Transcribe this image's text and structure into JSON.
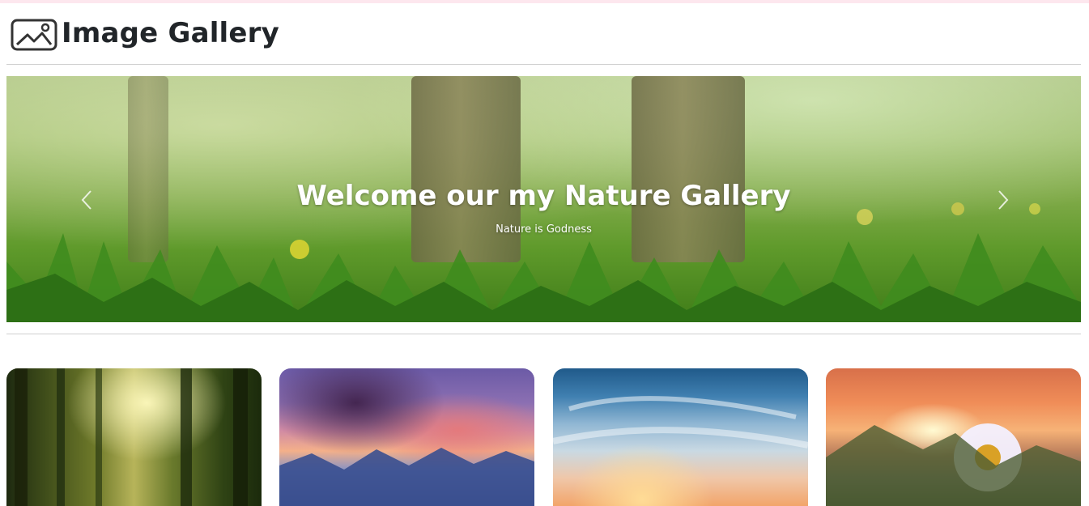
{
  "app": {
    "title": "Image Gallery",
    "logo_icon": "image-icon"
  },
  "carousel": {
    "caption_title": "Welcome our my Nature Gallery",
    "caption_subtitle": "Nature is Godness",
    "prev_icon": "chevron-left-icon",
    "next_icon": "chevron-right-icon"
  },
  "gallery": {
    "cards": [
      {
        "name": "forest",
        "accent": "#6f7a2a"
      },
      {
        "name": "sunset-clouds",
        "accent": "#8b6fb2"
      },
      {
        "name": "sky-sunrise",
        "accent": "#3f7fb0"
      },
      {
        "name": "daisy-sunset",
        "accent": "#f08d58"
      }
    ]
  },
  "colors": {
    "text": "#212529",
    "rule": "#cfcfcf",
    "top_line": "#fde7ee"
  }
}
